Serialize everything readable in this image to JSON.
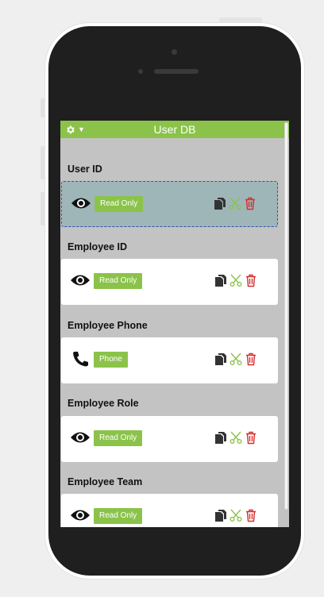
{
  "app": {
    "title": "User DB"
  },
  "fields": [
    {
      "label": "User ID",
      "badge": "Read Only",
      "icon": "eye-icon"
    },
    {
      "label": "Employee ID",
      "badge": "Read Only",
      "icon": "eye-icon"
    },
    {
      "label": "Employee Phone",
      "badge": "Phone",
      "icon": "phone-icon"
    },
    {
      "label": "Employee Role",
      "badge": "Read Only",
      "icon": "eye-icon"
    },
    {
      "label": "Employee Team",
      "badge": "Read Only",
      "icon": "eye-icon"
    }
  ],
  "colors": {
    "accent": "#8bc34a",
    "screen_bg": "#c3c3c3",
    "selected_card": "#9fb6b8",
    "delete": "#d32f2f"
  }
}
